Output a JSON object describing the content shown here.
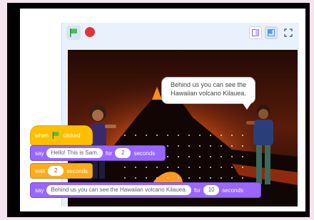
{
  "stage": {
    "speech_bubble": "Behind us you can see the Hawaiian volcano Kilauea."
  },
  "toolbar": {
    "icons": [
      "green-flag-icon",
      "stop-icon",
      "small-stage-icon",
      "large-stage-icon",
      "fullscreen-icon"
    ]
  },
  "script": {
    "hat": {
      "label_when": "when",
      "label_clicked": "clicked"
    },
    "say1": {
      "label_say": "say",
      "message": "Hello! This is Sam.",
      "label_for": "for",
      "secs": "2",
      "label_seconds": "seconds"
    },
    "wait": {
      "label_wait": "wait",
      "secs": "2",
      "label_seconds": "seconds"
    },
    "say2": {
      "label_say": "say",
      "message": "Behind us you can see the Hawaiian volcano Kilauea.",
      "label_for": "for",
      "secs": "10",
      "label_seconds": "seconds"
    }
  },
  "colors": {
    "events": "#ffbf00",
    "looks": "#9966ff",
    "control": "#ffab19",
    "stop": "#e5333b",
    "flag": "#4cbf56"
  }
}
